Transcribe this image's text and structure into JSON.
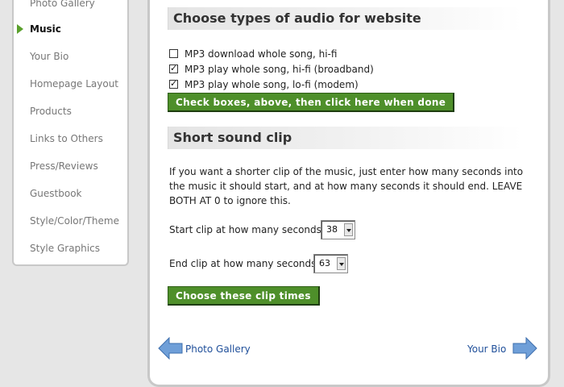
{
  "sidebar": {
    "items": [
      {
        "label": "Photo Gallery",
        "active": false
      },
      {
        "label": "Music",
        "active": true
      },
      {
        "label": "Your Bio",
        "active": false
      },
      {
        "label": "Homepage Layout",
        "active": false
      },
      {
        "label": "Products",
        "active": false
      },
      {
        "label": "Links to Others",
        "active": false
      },
      {
        "label": "Press/Reviews",
        "active": false
      },
      {
        "label": "Guestbook",
        "active": false
      },
      {
        "label": "Style/Color/Theme",
        "active": false
      },
      {
        "label": "Style Graphics",
        "active": false
      }
    ]
  },
  "audio_types": {
    "heading": "Choose types of audio for website",
    "options": [
      {
        "label": "MP3 download whole song, hi-fi",
        "checked": false
      },
      {
        "label": "MP3 play whole song, hi-fi (broadband)",
        "checked": true
      },
      {
        "label": "MP3 play whole song, lo-fi (modem)",
        "checked": true
      }
    ],
    "submit_label": "Check boxes, above, then click here when done"
  },
  "sound_clip": {
    "heading": "Short sound clip",
    "description": "If you want a shorter clip of the music, just enter how many seconds into the music it should start, and at how many seconds it should end. LEAVE BOTH AT 0 to ignore this.",
    "start_label": "Start clip at how many seconds:",
    "start_value": "38",
    "end_label": "End clip at how many seconds:",
    "end_value": "63",
    "submit_label": "Choose these clip times"
  },
  "pager": {
    "prev_label": "Photo Gallery",
    "next_label": "Your Bio"
  },
  "colors": {
    "accent_green": "#4e8f2a",
    "link_blue": "#1f4f9a",
    "arrow_blue": "#6f9fd8"
  }
}
